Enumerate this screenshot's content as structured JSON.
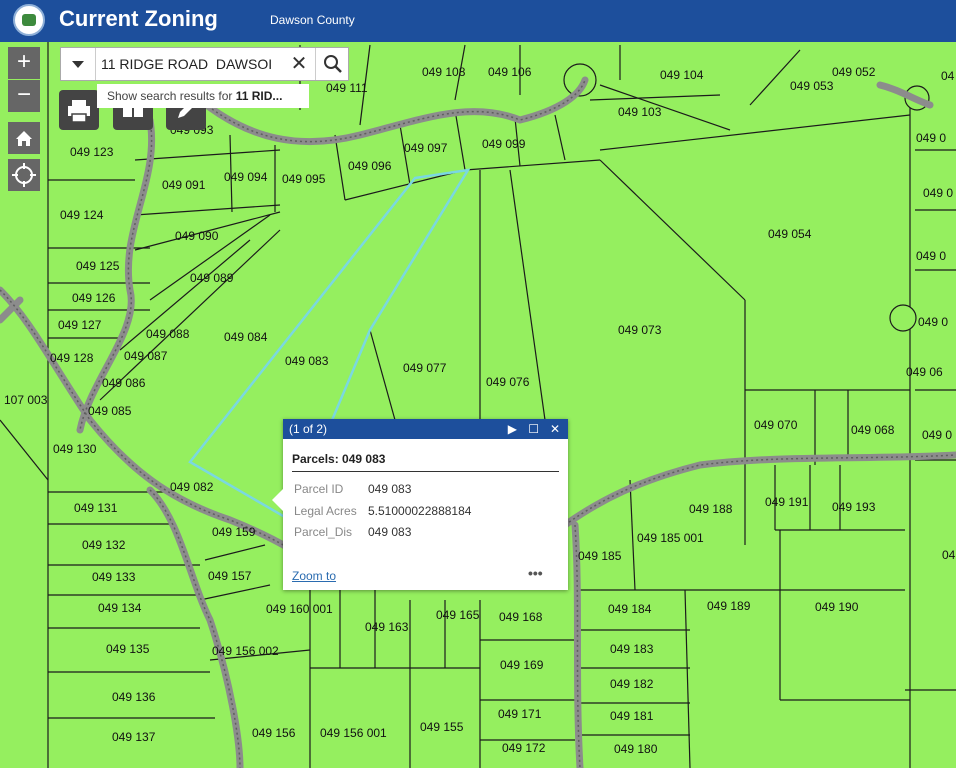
{
  "app": {
    "title": "Current Zoning",
    "subtitle": "Dawson County"
  },
  "colors": {
    "header": "#1d4f9c",
    "parcel_fill": "#95ef5f",
    "road": "#8c8c8c",
    "selected_outline": "#7ad8e0"
  },
  "search": {
    "value": "11 RIDGE ROAD  DAWSOI",
    "suggestion_prefix": "Show search results for ",
    "suggestion_term": "11 RID..."
  },
  "map_labels": [
    "049 108",
    "049 106",
    "049 104",
    "049 052",
    "049 053",
    "049 111",
    "049 103",
    "049 123",
    "049 093",
    "049 097",
    "049 099",
    "049 091",
    "049 094",
    "049 095",
    "049 096",
    "049 124",
    "049 090",
    "049 054",
    "049 125",
    "049 089",
    "049 126",
    "049 127",
    "049 088",
    "049 084",
    "049 073",
    "049 128",
    "049 087",
    "049 083",
    "049 077",
    "049 076",
    "049 086",
    "107 003",
    "049 085",
    "049 070",
    "049 068",
    "049 130",
    "049 082",
    "049 131",
    "049 159",
    "049 188",
    "049 191",
    "049 193",
    "049 132",
    "049 185",
    "049 185 001",
    "049 133",
    "049 157",
    "049 134",
    "049 160 001",
    "049 165",
    "049 168",
    "049 184",
    "049 189",
    "049 190",
    "049 163",
    "049 135",
    "049 156 002",
    "049 183",
    "049 169",
    "049 182",
    "049 136",
    "049 171",
    "049 181",
    "049 137",
    "049 156",
    "049 156 001",
    "049 155",
    "049 172",
    "049 180",
    "049 0",
    "049 0",
    "049 0",
    "049 0",
    "049 06",
    "049 0",
    "04",
    "04"
  ],
  "popup": {
    "counter": "(1 of 2)",
    "title": "Parcels: 049 083",
    "fields": [
      {
        "key": "Parcel ID",
        "value": "049 083"
      },
      {
        "key": "Legal Acres",
        "value": "5.51000022888184"
      },
      {
        "key": "Parcel_Dis",
        "value": "049 083"
      }
    ],
    "zoom_to": "Zoom to",
    "more": "•••"
  },
  "icons": {
    "zoom_in": "+",
    "zoom_out": "−",
    "clear": "✕"
  }
}
